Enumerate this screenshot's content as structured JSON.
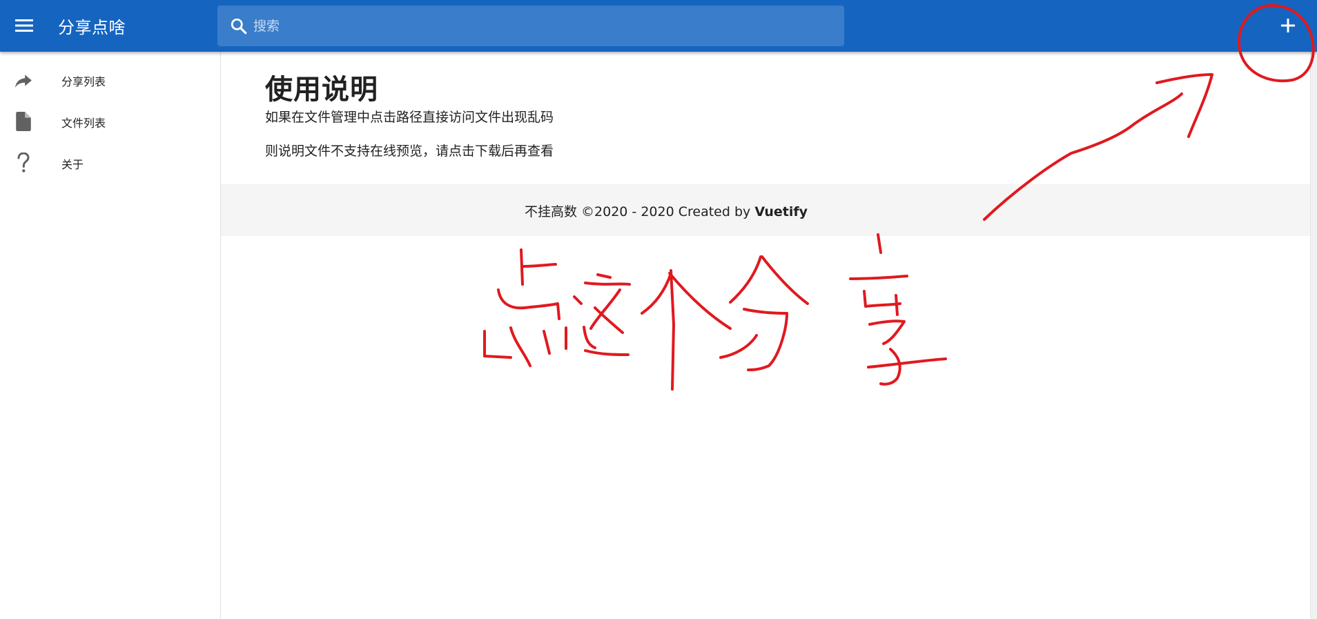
{
  "app_bar": {
    "title": "分享点啥",
    "menu_icon": "hamburger-menu-icon",
    "search": {
      "placeholder": "搜索",
      "value": "",
      "icon": "search-icon"
    },
    "add_icon": "plus-icon",
    "background_color": "#1565c0"
  },
  "sidebar": {
    "items": [
      {
        "label": "分享列表",
        "icon": "share-arrow-icon"
      },
      {
        "label": "文件列表",
        "icon": "file-icon"
      },
      {
        "label": "关于",
        "icon": "question-mark-icon"
      }
    ]
  },
  "main": {
    "title": "使用说明",
    "paragraphs": [
      "如果在文件管理中点击路径直接访问文件出现乱码",
      "则说明文件不支持在线预览，请点击下载后再查看"
    ],
    "footer": {
      "text": "不挂高数 ©2020 - 2020 Created by ",
      "brand": "Vuetify"
    }
  },
  "annotation": {
    "text": "点这个分享",
    "color": "#e0191f",
    "shapes": [
      "circle-around-plus-button",
      "arrow-pointing-to-plus-button"
    ]
  }
}
